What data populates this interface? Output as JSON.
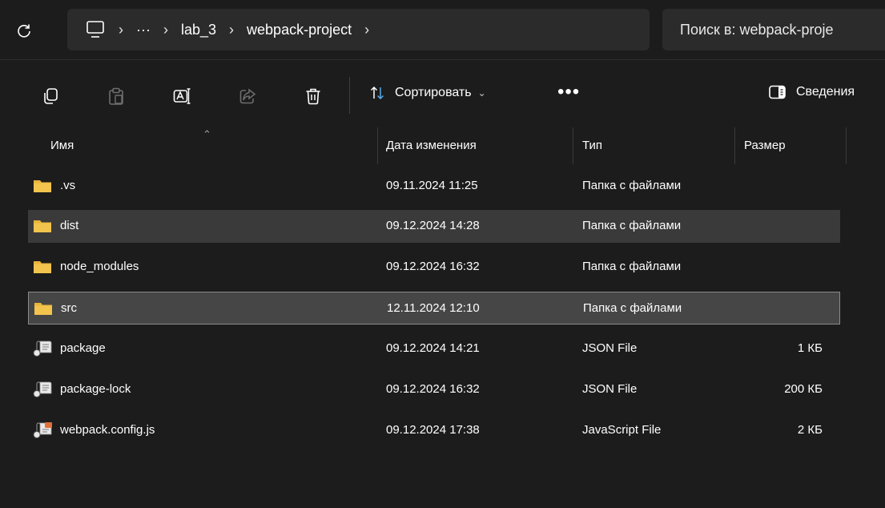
{
  "address_bar": {
    "breadcrumbs": [
      "lab_3",
      "webpack-project"
    ],
    "more": "···",
    "icons": {
      "refresh": "refresh-icon",
      "root": "this-pc-icon"
    }
  },
  "search": {
    "placeholder": "Поиск в: webpack-proje"
  },
  "toolbar": {
    "sort_label": "Сортировать",
    "more_label": "•••",
    "details_label": "Сведения",
    "icons": [
      "copy-icon",
      "paste-icon",
      "rename-icon",
      "share-icon",
      "delete-icon",
      "sort-icon",
      "details-pane-icon"
    ]
  },
  "columns": {
    "name": "Имя",
    "date": "Дата изменения",
    "type": "Тип",
    "size": "Размер"
  },
  "files": [
    {
      "name": ".vs",
      "date": "09.11.2024 11:25",
      "type": "Папка с файлами",
      "size": "",
      "icon": "folder-icon",
      "state": "normal"
    },
    {
      "name": "dist",
      "date": "09.12.2024 14:28",
      "type": "Папка с файлами",
      "size": "",
      "icon": "folder-icon",
      "state": "selected"
    },
    {
      "name": "node_modules",
      "date": "09.12.2024 16:32",
      "type": "Папка с файлами",
      "size": "",
      "icon": "folder-icon",
      "state": "normal"
    },
    {
      "name": "src",
      "date": "12.11.2024 12:10",
      "type": "Папка с файлами",
      "size": "",
      "icon": "folder-icon",
      "state": "focused"
    },
    {
      "name": "package",
      "date": "09.12.2024 14:21",
      "type": "JSON File",
      "size": "1 КБ",
      "icon": "json-file-icon",
      "state": "normal"
    },
    {
      "name": "package-lock",
      "date": "09.12.2024 16:32",
      "type": "JSON File",
      "size": "200 КБ",
      "icon": "json-file-icon",
      "state": "normal"
    },
    {
      "name": "webpack.config.js",
      "date": "09.12.2024 17:38",
      "type": "JavaScript File",
      "size": "2 КБ",
      "icon": "js-file-icon",
      "state": "normal"
    }
  ],
  "colors": {
    "background": "#1c1c1c",
    "bar": "#2b2b2b",
    "selected": "#3a3a3a",
    "folder": "#f2c44d"
  }
}
